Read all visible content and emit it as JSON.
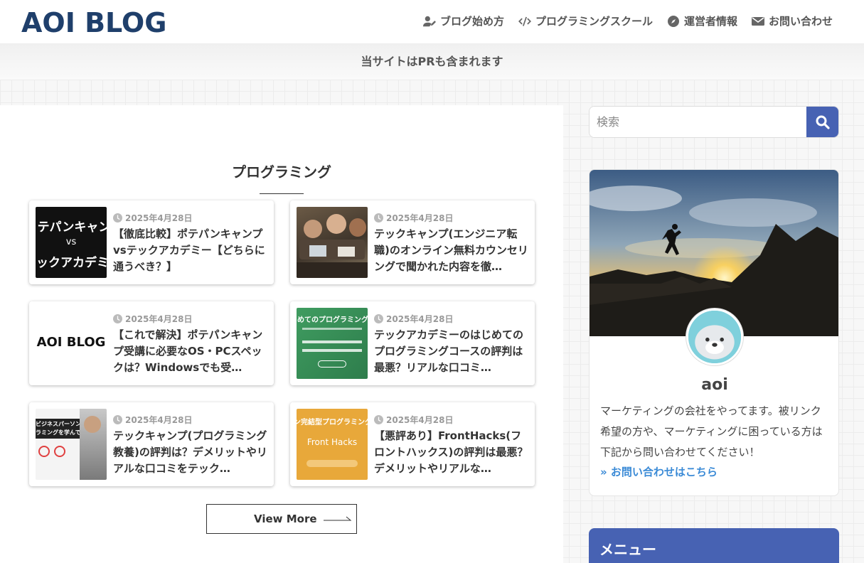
{
  "header": {
    "logo": "AOI BLOG",
    "nav": [
      {
        "label": "ブログ始め方",
        "icon": "user-edit-icon"
      },
      {
        "label": "プログラミングスクール",
        "icon": "code-icon"
      },
      {
        "label": "運営者情報",
        "icon": "compass-icon"
      },
      {
        "label": "お問い合わせ",
        "icon": "envelope-icon"
      }
    ]
  },
  "notice": "当サイトはPRも含まれます",
  "main": {
    "section_title": "プログラミング",
    "articles": [
      {
        "date": "2025年4月28日",
        "title": "【徹底比較】ポテパンキャンプvsテックアカデミー【どちらに通うべき？】",
        "thumb_lines": [
          "テパンキャン",
          "vs",
          "ックアカデミ"
        ]
      },
      {
        "date": "2025年4月28日",
        "title": "テックキャンプ(エンジニア転職)のオンライン無料カウンセリングで聞かれた内容を徹…"
      },
      {
        "date": "2025年4月28日",
        "title": "【これで解決】ポテパンキャンプ受講に必要なOS・PCスペックは？Windowsでも受…",
        "thumb_lines": [
          "AOI BLOG"
        ]
      },
      {
        "date": "2025年4月28日",
        "title": "テックアカデミーのはじめてのプログラミングコースの評判は最悪？リアルな口コミ…",
        "thumb_lines": [
          "めてのプログラミング"
        ]
      },
      {
        "date": "2025年4月28日",
        "title": "テックキャンプ(プログラミング教養)の評判は？デメリットやリアルな口コミをテック…",
        "thumb_lines": [
          "ビジネスパーソンは",
          "ラミングを学んでいる"
        ]
      },
      {
        "date": "2025年4月28日",
        "title": "【悪評あり】FrontHacks(フロントハックス)の評判は最悪？デメリットやリアルな…",
        "thumb_lines": [
          "ン完結型プログラミング",
          "Front Hacks"
        ]
      }
    ],
    "view_more": "View More"
  },
  "sidebar": {
    "search_placeholder": "検索",
    "profile": {
      "name": "aoi",
      "description": "マーケティングの会社をやってます。被リンク希望の方や、マーケティングに困っている方は下記から問い合わせてください！",
      "link": "» お問い合わせはこちら"
    },
    "menu_title": "メニュー"
  },
  "colors": {
    "accent": "#4762b3",
    "logo": "#1f3f6b",
    "link": "#3a8ad6"
  }
}
